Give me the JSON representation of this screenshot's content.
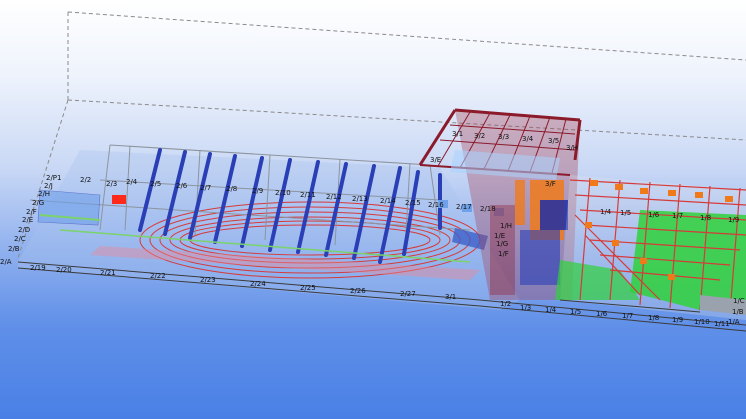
{
  "colors": {
    "background_top": "#ffffff",
    "background_bottom": "#4a80e6",
    "column_blue": "#2a3fb5",
    "track_red": "#d63a3a",
    "stand_green": "#2fd13a",
    "roof_maroon": "#8b1a2a",
    "orange_block": "#f07a1a",
    "grey_steel": "#9aa2ad"
  },
  "grid_labels": [
    "2/P1",
    "2/J",
    "2/2",
    "2/H",
    "2/3",
    "2/4",
    "2/G",
    "2/5",
    "2/6",
    "2/F",
    "2/7",
    "2/8",
    "2/E",
    "2/9",
    "2/D",
    "2/10",
    "2/C",
    "2/11",
    "2/B",
    "2/12",
    "2/13",
    "2/A",
    "2/14",
    "2/15",
    "2/16",
    "2/17",
    "2/18",
    "2/19",
    "2/20",
    "2/21",
    "2/22",
    "2/23",
    "2/24",
    "2/25",
    "2/26",
    "2/27",
    "3/1",
    "3/2",
    "3/3",
    "3/4",
    "3/5",
    "3/E",
    "3/F",
    "3/H",
    "1/E",
    "1/F",
    "1/G",
    "1/H",
    "1/2",
    "1/3",
    "1/4",
    "1/5",
    "1/6",
    "1/7",
    "1/8",
    "1/9",
    "1/10",
    "1/11",
    "1/12",
    "1/A",
    "1/B",
    "1/C",
    "1/D"
  ]
}
